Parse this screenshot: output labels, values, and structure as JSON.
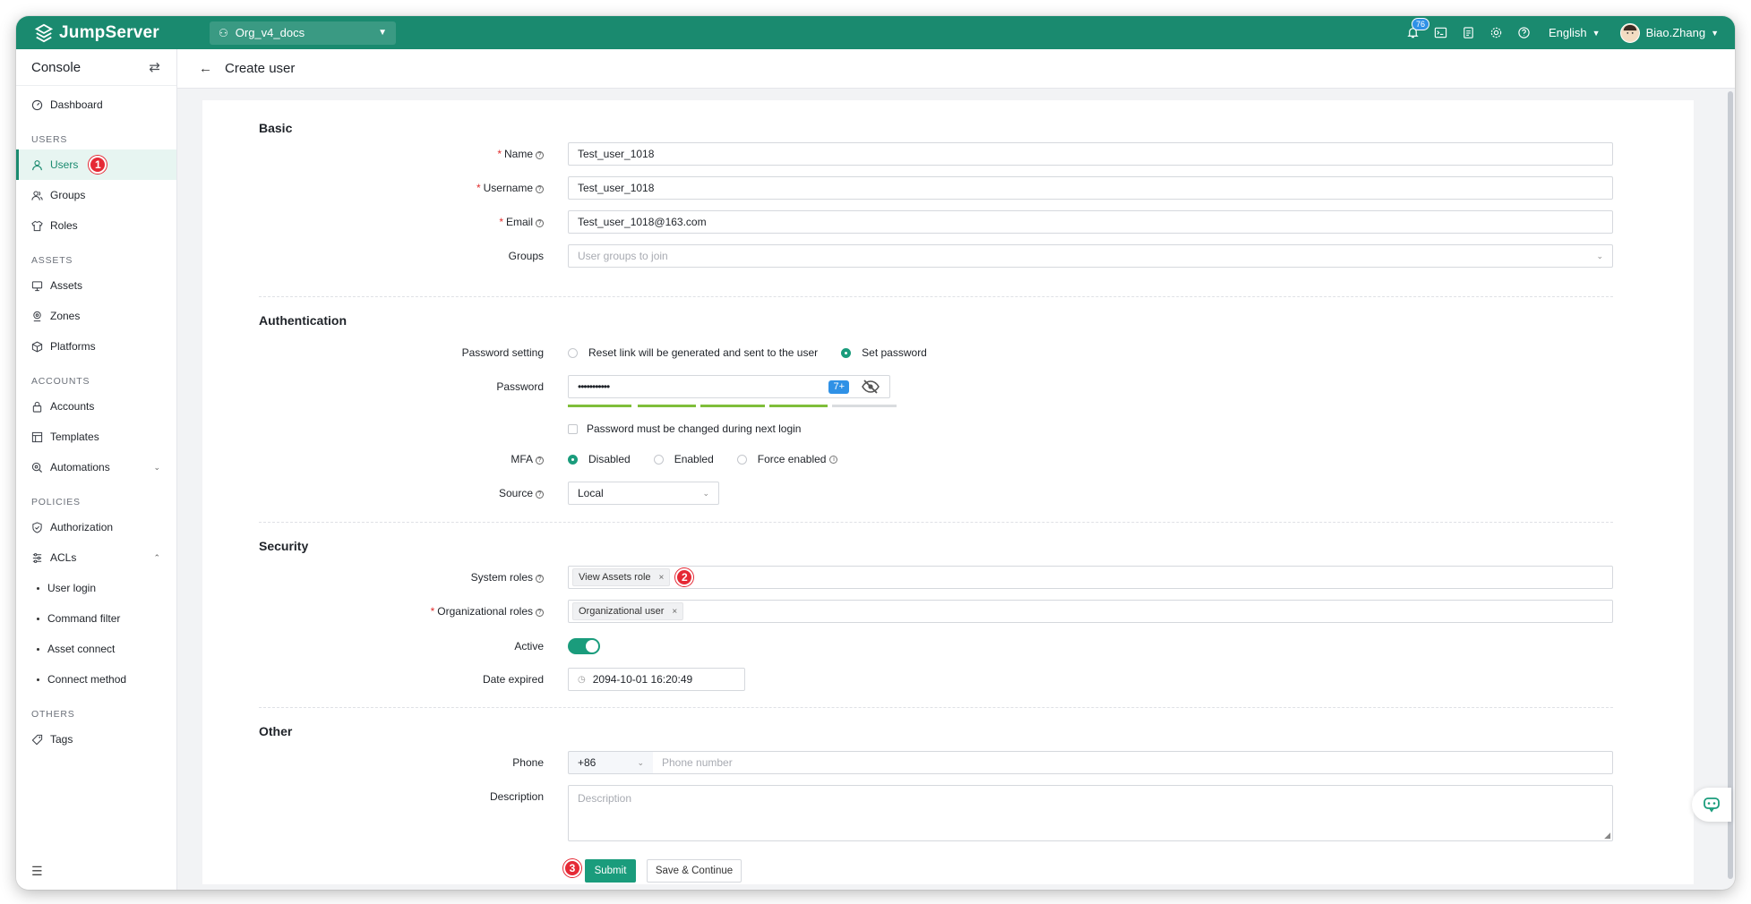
{
  "header": {
    "logo_text": "JumpServer",
    "org": "Org_v4_docs",
    "notification_count": "76",
    "language": "English",
    "user_name": "Biao.Zhang"
  },
  "sidebar": {
    "title": "Console",
    "items": {
      "dashboard": "Dashboard",
      "group_users": "USERS",
      "users": "Users",
      "groups": "Groups",
      "roles": "Roles",
      "group_assets": "ASSETS",
      "assets": "Assets",
      "zones": "Zones",
      "platforms": "Platforms",
      "group_accounts": "ACCOUNTS",
      "accounts": "Accounts",
      "templates": "Templates",
      "automations": "Automations",
      "group_policies": "POLICIES",
      "authorization": "Authorization",
      "acls": "ACLs",
      "user_login": "User login",
      "command_filter": "Command filter",
      "asset_connect": "Asset connect",
      "connect_method": "Connect method",
      "group_others": "OTHERS",
      "tags": "Tags"
    }
  },
  "steps": {
    "one": "1",
    "two": "2",
    "three": "3"
  },
  "page": {
    "title": "Create user"
  },
  "form": {
    "basic": {
      "title": "Basic",
      "name_label": "Name",
      "name_value": "Test_user_1018",
      "username_label": "Username",
      "username_value": "Test_user_1018",
      "email_label": "Email",
      "email_value": "Test_user_1018@163.com",
      "groups_label": "Groups",
      "groups_placeholder": "User groups to join"
    },
    "authentication": {
      "title": "Authentication",
      "password_setting_label": "Password setting",
      "option_reset": "Reset link will be generated and sent to the user",
      "option_set": "Set password",
      "password_label": "Password",
      "password_value": "•••••••••••",
      "password_length_badge": "7+",
      "password_strength": 0.8,
      "must_change_label": "Password must be changed during next login",
      "mfa_label": "MFA",
      "mfa_disabled": "Disabled",
      "mfa_enabled": "Enabled",
      "mfa_force": "Force enabled",
      "source_label": "Source",
      "source_value": "Local"
    },
    "security": {
      "title": "Security",
      "system_roles_label": "System roles",
      "system_roles_tag": "View Assets role",
      "org_roles_label": "Organizational roles",
      "org_roles_tag": "Organizational user",
      "active_label": "Active",
      "date_expired_label": "Date expired",
      "date_expired_value": "2094-10-01 16:20:49"
    },
    "other": {
      "title": "Other",
      "phone_label": "Phone",
      "phone_code": "+86",
      "phone_placeholder": "Phone number",
      "description_label": "Description",
      "description_placeholder": "Description"
    },
    "buttons": {
      "submit": "Submit",
      "save_continue": "Save & Continue"
    }
  },
  "colors": {
    "brand": "#1a8a6f",
    "accent": "#1a9c7c",
    "step_badge": "#e52935"
  }
}
